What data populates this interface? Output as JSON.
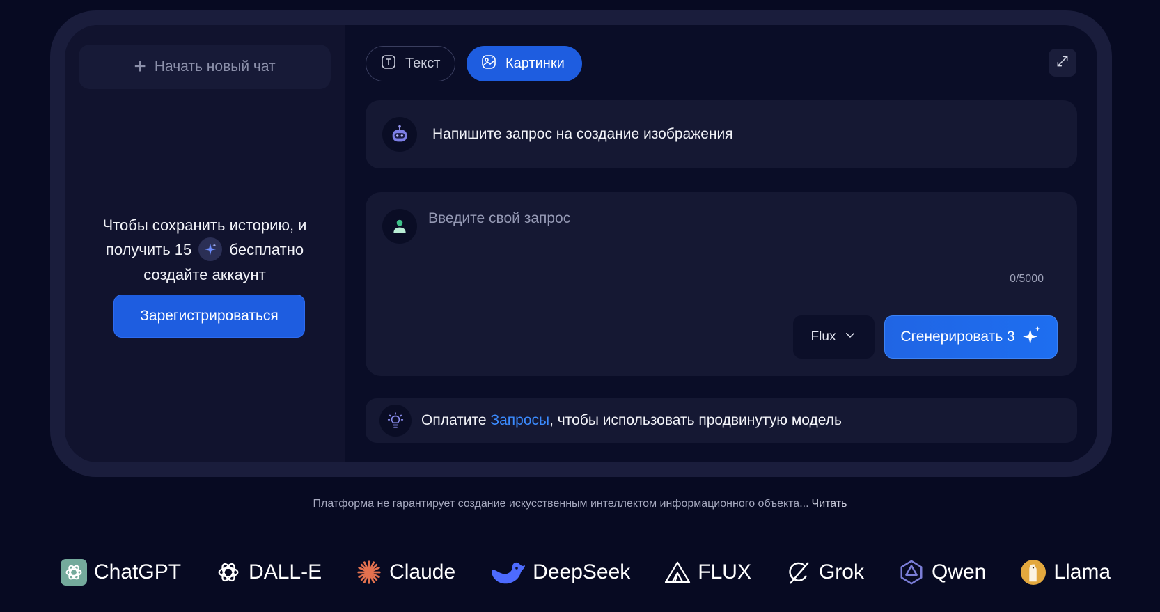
{
  "sidebar": {
    "new_chat_label": "Начать новый чат",
    "promo_line1": "Чтобы сохранить историю, и",
    "promo_line2_before": "получить 15",
    "promo_line2_after": "бесплатно",
    "promo_line3": "создайте аккаунт",
    "register_label": "Зарегистрироваться"
  },
  "tabs": {
    "text_label": "Текст",
    "images_label": "Картинки",
    "active": "images"
  },
  "bot_message": "Напишите запрос на создание изображения",
  "input": {
    "placeholder": "Введите свой запрос",
    "value": "",
    "counter": "0/5000"
  },
  "model_select": {
    "selected": "Flux"
  },
  "generate_button": {
    "label": "Сгенерировать 3"
  },
  "notice": {
    "prefix": "Оплатите",
    "link": "Запросы",
    "suffix": ", чтобы использовать продвинутую модель"
  },
  "footer": {
    "disclaimer": "Платформа не гарантирует создание искусственным интеллектом информационного объекта...",
    "read_link": "Читать"
  },
  "models": [
    {
      "name": "ChatGPT",
      "icon": "chatgpt-icon"
    },
    {
      "name": "DALL-E",
      "icon": "dalle-icon"
    },
    {
      "name": "Claude",
      "icon": "claude-icon"
    },
    {
      "name": "DeepSeek",
      "icon": "deepseek-icon"
    },
    {
      "name": "FLUX",
      "icon": "flux-icon"
    },
    {
      "name": "Grok",
      "icon": "grok-icon"
    },
    {
      "name": "Qwen",
      "icon": "qwen-icon"
    },
    {
      "name": "Llama",
      "icon": "llama-icon"
    }
  ],
  "colors": {
    "accent": "#1e5de0",
    "link": "#3b8bff",
    "background": "#070a22",
    "card": "#151833"
  }
}
